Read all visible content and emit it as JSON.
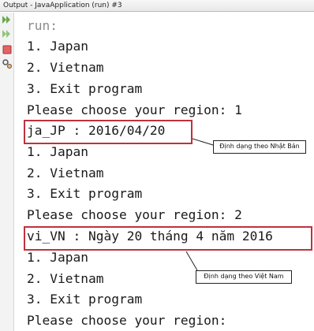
{
  "window": {
    "title": "Output - JavaApplication (run) #3"
  },
  "toolbar": {
    "buttons": [
      "rerun-icon",
      "rerun-with-options-icon",
      "stop-icon",
      "run-settings-icon"
    ]
  },
  "console": {
    "lines": [
      "run:",
      "1. Japan",
      "2. Vietnam",
      "3. Exit program",
      "Please choose your region: 1",
      "ja_JP : 2016/04/20",
      "1. Japan",
      "2. Vietnam",
      "3. Exit program",
      "Please choose your region: 2",
      "vi_VN : Ngày 20 tháng 4 năm 2016",
      "1. Japan",
      "2. Vietnam",
      "3. Exit program",
      "Please choose your region:"
    ]
  },
  "annotations": {
    "japan_note": "Định dạng theo Nhật Bản",
    "vietnam_note": "Định dạng theo Việt Nam",
    "highlight_color": "#c0313d"
  }
}
